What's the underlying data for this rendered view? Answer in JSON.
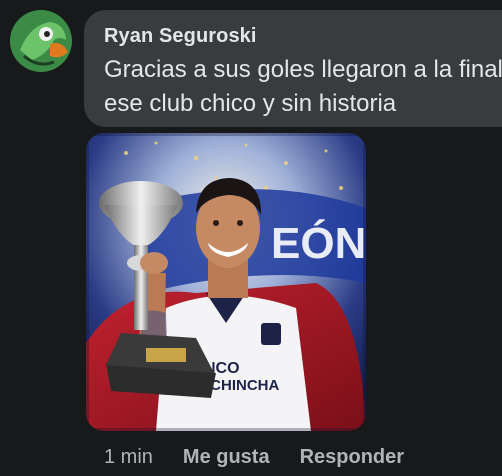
{
  "comment": {
    "author": "Ryan Seguroski",
    "text_lines": [
      "Gracias a sus goles llegaron a la final",
      "ese club chico y sin historia"
    ],
    "time": "1 min",
    "like_label": "Me gusta",
    "reply_label": "Responder"
  },
  "image": {
    "banner_text": "EÓN",
    "shirt_text_1": "NCO",
    "shirt_text_2": "PICHINCHA"
  },
  "colors": {
    "background": "#18191a",
    "bubble": "#3a3b3c",
    "text": "#e4e6eb",
    "secondary_text": "#b0b3b8"
  }
}
